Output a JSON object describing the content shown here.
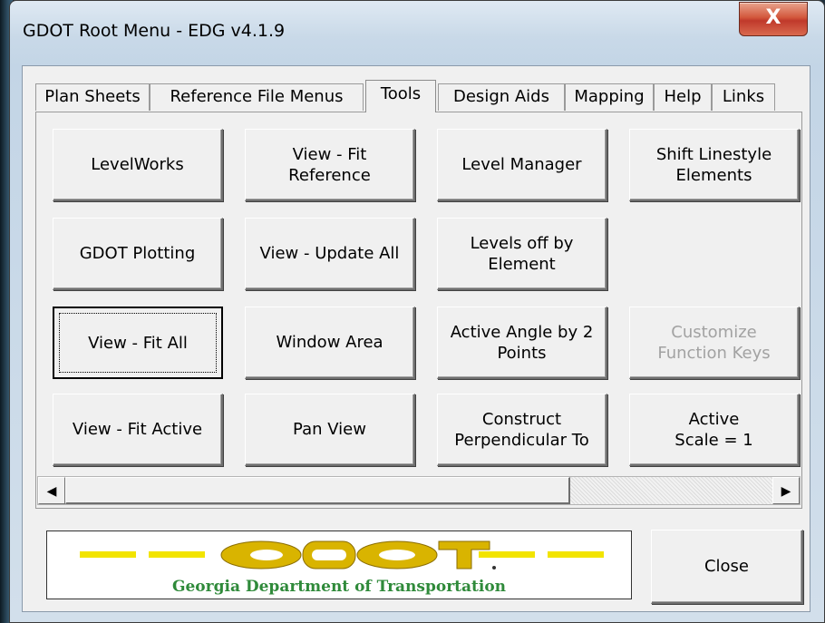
{
  "window": {
    "title": "GDOT Root Menu - EDG v4.1.9",
    "close_glyph": "X"
  },
  "tabs": [
    {
      "label": "Plan Sheets"
    },
    {
      "label": "Reference File Menus"
    },
    {
      "label": "Tools",
      "active": true
    },
    {
      "label": "Design Aids"
    },
    {
      "label": "Mapping"
    },
    {
      "label": "Help"
    },
    {
      "label": "Links"
    }
  ],
  "tools": {
    "levelworks": "LevelWorks",
    "view_fit_reference": "View - Fit\nReference",
    "level_manager": "Level Manager",
    "shift_linestyle": "Shift Linestyle\nElements",
    "gdot_plotting": "GDOT Plotting",
    "view_update_all": "View - Update All",
    "levels_off_by_element": "Levels off by\nElement",
    "view_fit_all": "View - Fit All",
    "window_area": "Window Area",
    "active_angle": "Active Angle by 2\nPoints",
    "customize_function_keys": "Customize\nFunction Keys",
    "view_fit_active": "View - Fit Active",
    "pan_view": "Pan View",
    "construct_perpendicular": "Construct\nPerpendicular To",
    "active_scale": "Active\nScale = 1"
  },
  "scrollbar": {
    "left_arrow": "◀",
    "right_arrow": "▶"
  },
  "logo": {
    "wordmark": "GDOT",
    "agency_name": "Georgia Department of Transportation",
    "colors": {
      "gold": "#d9b400",
      "yellow_bar": "#f2e400",
      "green_text": "#2f8a3a"
    }
  },
  "close_button": "Close"
}
